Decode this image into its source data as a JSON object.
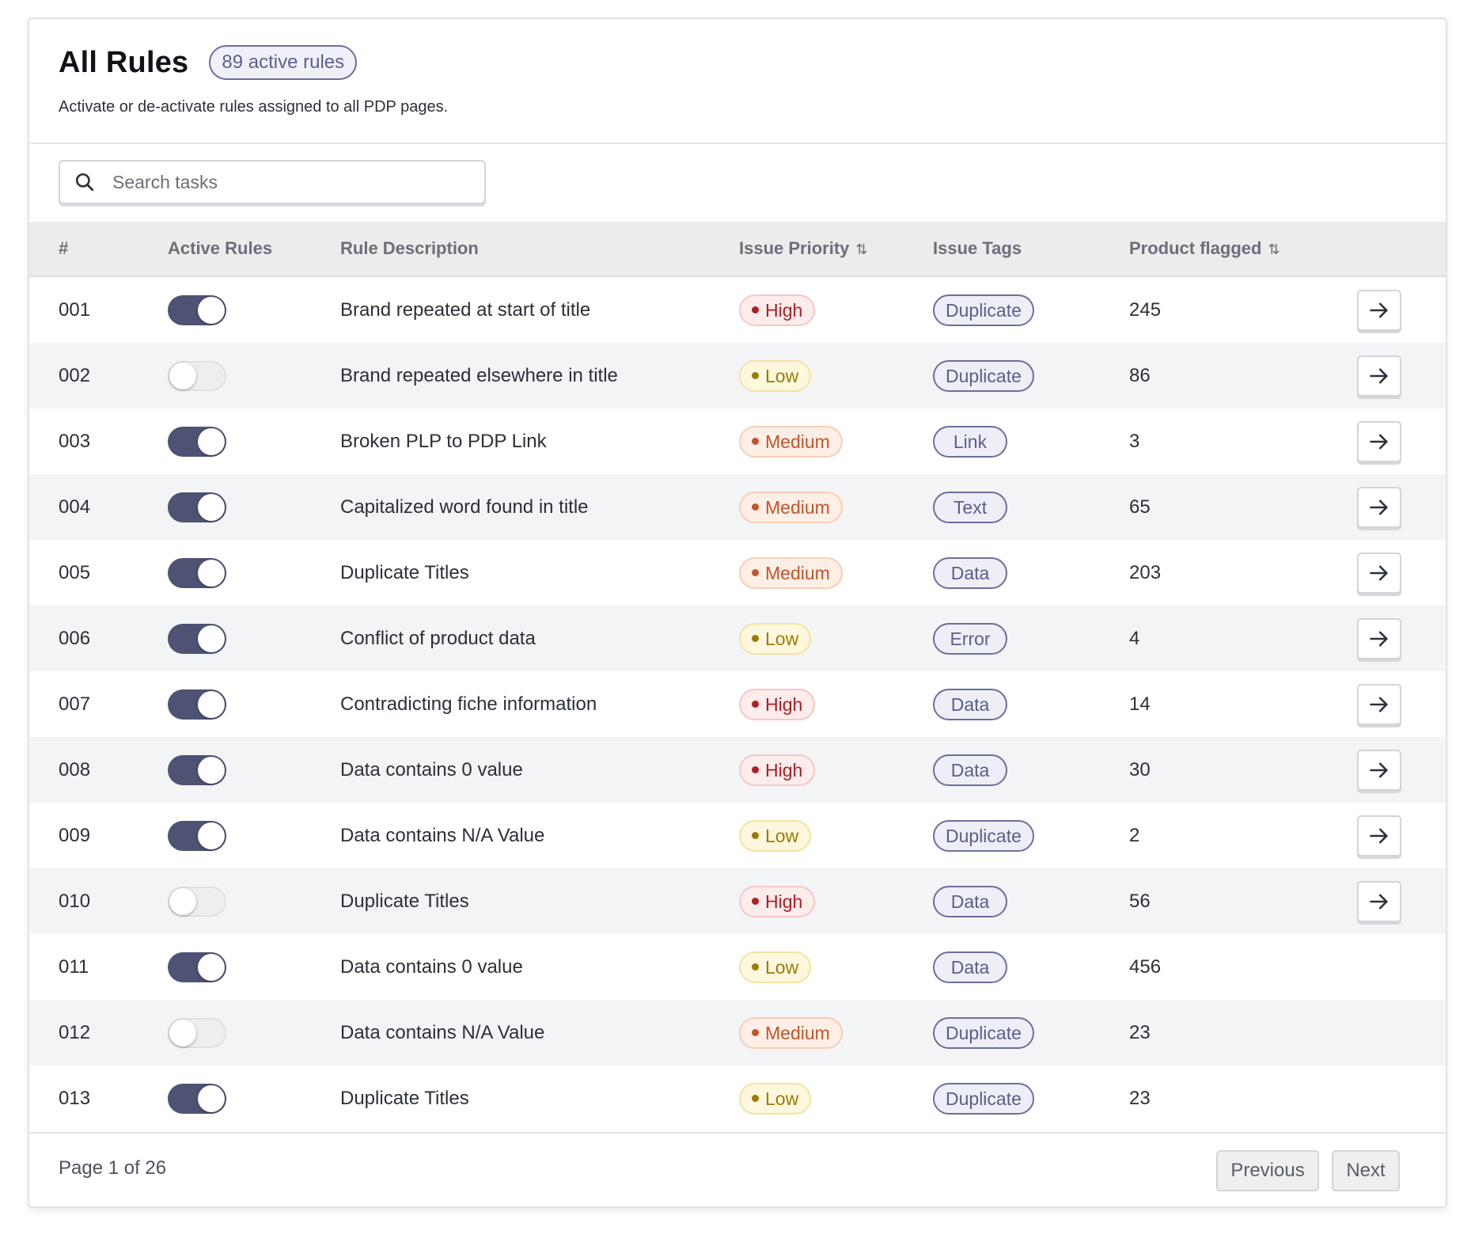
{
  "header": {
    "title": "All Rules",
    "count_badge": "89 active rules",
    "subtitle": "Activate or de-activate rules assigned to all PDP pages."
  },
  "search": {
    "placeholder": "Search tasks",
    "value": ""
  },
  "table": {
    "columns": {
      "num": "#",
      "active": "Active Rules",
      "description": "Rule Description",
      "priority": "Issue Priority",
      "tags": "Issue Tags",
      "flagged": "Product flagged"
    },
    "rows": [
      {
        "id": "001",
        "active": true,
        "description": "Brand repeated at start of title",
        "priority": "High",
        "tag": "Duplicate",
        "flagged": "245",
        "has_action": true
      },
      {
        "id": "002",
        "active": false,
        "description": "Brand repeated elsewhere in title",
        "priority": "Low",
        "tag": "Duplicate",
        "flagged": "86",
        "has_action": true
      },
      {
        "id": "003",
        "active": true,
        "description": "Broken PLP to PDP Link",
        "priority": "Medium",
        "tag": "Link",
        "flagged": "3",
        "has_action": true
      },
      {
        "id": "004",
        "active": true,
        "description": "Capitalized word found in title",
        "priority": "Medium",
        "tag": "Text",
        "flagged": "65",
        "has_action": true
      },
      {
        "id": "005",
        "active": true,
        "description": "Duplicate Titles",
        "priority": "Medium",
        "tag": "Data",
        "flagged": "203",
        "has_action": true
      },
      {
        "id": "006",
        "active": true,
        "description": "Conflict of product data",
        "priority": "Low",
        "tag": "Error",
        "flagged": "4",
        "has_action": true
      },
      {
        "id": "007",
        "active": true,
        "description": "Contradicting fiche information",
        "priority": "High",
        "tag": "Data",
        "flagged": "14",
        "has_action": true
      },
      {
        "id": "008",
        "active": true,
        "description": "Data contains 0 value",
        "priority": "High",
        "tag": "Data",
        "flagged": "30",
        "has_action": true
      },
      {
        "id": "009",
        "active": true,
        "description": "Data contains N/A Value",
        "priority": "Low",
        "tag": "Duplicate",
        "flagged": "2",
        "has_action": true
      },
      {
        "id": "010",
        "active": false,
        "description": "Duplicate Titles",
        "priority": "High",
        "tag": "Data",
        "flagged": "56",
        "has_action": true
      },
      {
        "id": "011",
        "active": true,
        "description": "Data contains 0 value",
        "priority": "Low",
        "tag": "Data",
        "flagged": "456",
        "has_action": false
      },
      {
        "id": "012",
        "active": false,
        "description": "Data contains N/A Value",
        "priority": "Medium",
        "tag": "Duplicate",
        "flagged": "23",
        "has_action": false
      },
      {
        "id": "013",
        "active": true,
        "description": "Duplicate Titles",
        "priority": "Low",
        "tag": "Duplicate",
        "flagged": "23",
        "has_action": false
      }
    ]
  },
  "pagination": {
    "info": "Page 1 of 26",
    "previous_label": "Previous",
    "next_label": "Next"
  },
  "colors": {
    "toggle_on": "#4e5273",
    "priority_high": "#b01d24",
    "priority_medium": "#c4532a",
    "priority_low": "#9a7a08",
    "tag_accent": "#6c6f9a"
  },
  "icons": {
    "search": "search-icon",
    "sort": "sort-icon",
    "row_action": "arrow-right-icon"
  }
}
